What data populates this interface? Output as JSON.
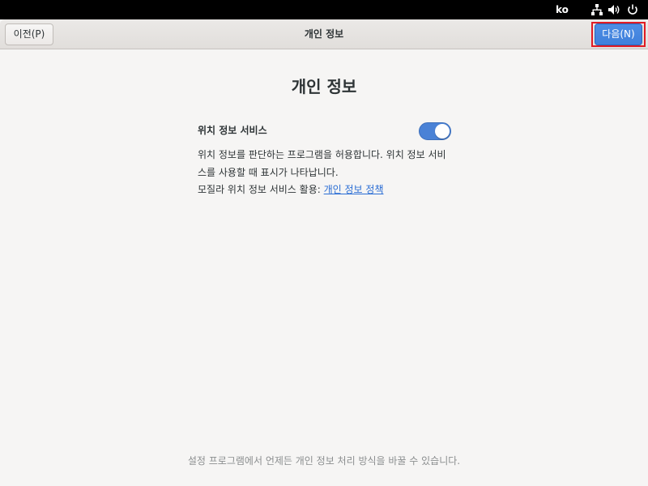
{
  "system_bar": {
    "language": "ko",
    "icons": [
      "network-icon",
      "volume-icon",
      "power-icon"
    ]
  },
  "header": {
    "title": "개인 정보",
    "prev_label": "이전(P)",
    "next_label": "다음(N)"
  },
  "main": {
    "heading": "개인 정보",
    "location": {
      "title": "위치 정보 서비스",
      "enabled": true,
      "description": "위치 정보를 판단하는 프로그램을 허용합니다. 위치 정보 서비스를 사용할 때 표시가 나타납니다.",
      "policy_prefix": "모질라 위치 정보 서비스 활용:",
      "policy_link": "개인 정보 정책"
    },
    "footer": "설정 프로그램에서 언제든 개인 정보 처리 방식을 바꿀 수 있습니다."
  },
  "colors": {
    "accent": "#4a82d6",
    "link": "#2a6dd4",
    "highlight_border": "#e01b24"
  }
}
